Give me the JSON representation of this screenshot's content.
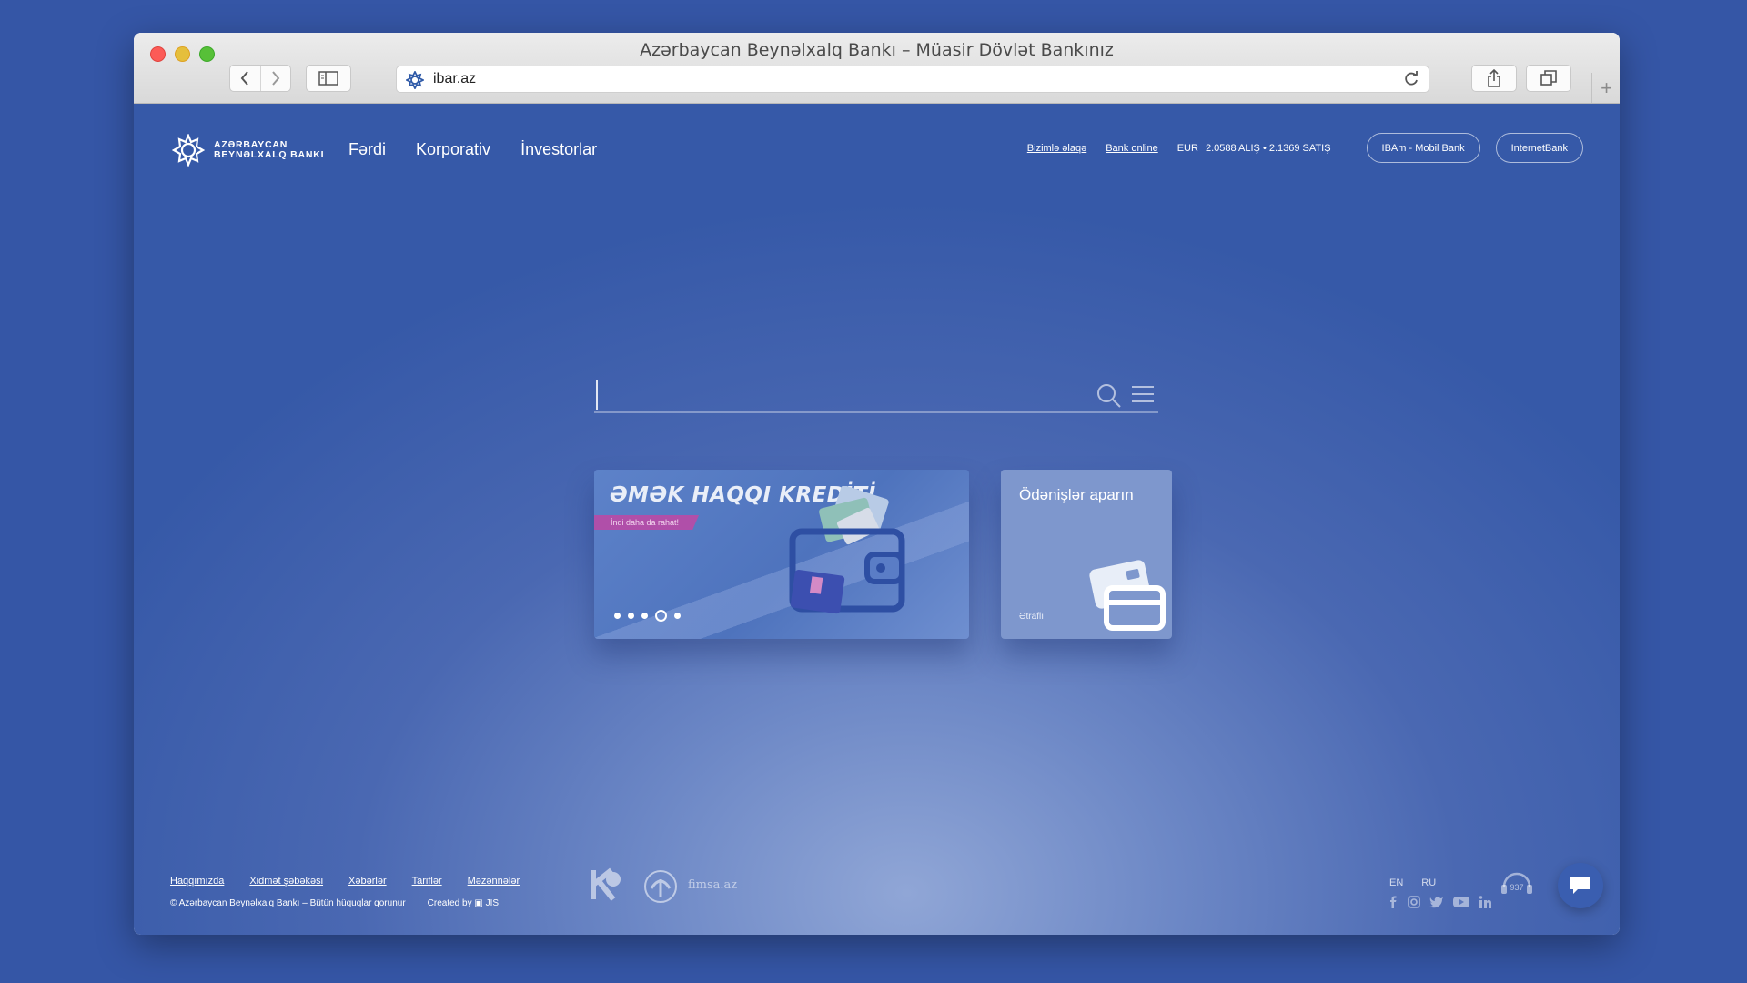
{
  "browser": {
    "window_title": "Azərbaycan Beynəlxalq Bankı – Müasir Dövlət Bankınız",
    "url": "ibar.az",
    "new_tab": "+"
  },
  "header": {
    "logo_line1": "AZƏRBAYCAN",
    "logo_line2": "BEYNƏLXALQ BANKI",
    "nav": [
      "Fərdi",
      "Korporativ",
      "İnvestorlar"
    ],
    "contact_link": "Bizimlə əlaqə",
    "bank_online_link": "Bank online",
    "rate_currency": "EUR",
    "rate_value": "2.0588 ALIŞ • 2.1369 SATIŞ",
    "mobile_bank_button": "IBAm - Mobil Bank",
    "internet_bank_button": "InternetBank"
  },
  "search": {
    "placeholder": ""
  },
  "promo": {
    "title": "ƏMƏK HAQQI KREDİTİ",
    "tag": "İndi daha da rahat!",
    "slides": 5,
    "active_slide": 4
  },
  "payments_card": {
    "title": "Ödənişlər aparın",
    "link": "Ətraflı"
  },
  "footer": {
    "links": [
      "Haqqımızda",
      "Xidmət şəbəkəsi",
      "Xəbərlər",
      "Tariflər",
      "Məzənnələr"
    ],
    "copyright": "© Azərbaycan Beynəlxalq Bankı – Bütün hüquqlar qorunur",
    "created_by_label": "Created by",
    "created_by_name": "JIS",
    "partner_text": "fimsa.az",
    "languages": [
      "EN",
      "RU"
    ],
    "hotline": "937"
  },
  "colors": {
    "page_background": "#3556a6",
    "promo_tag": "#b04fa9",
    "card": "#7e97cd"
  },
  "icons": [
    "back-icon",
    "forward-icon",
    "sidebar-icon",
    "site-icon",
    "reload-icon",
    "share-icon",
    "tabs-icon",
    "search-icon",
    "menu-icon",
    "facebook-icon",
    "instagram-icon",
    "twitter-icon",
    "youtube-icon",
    "linkedin-icon",
    "chat-icon"
  ]
}
